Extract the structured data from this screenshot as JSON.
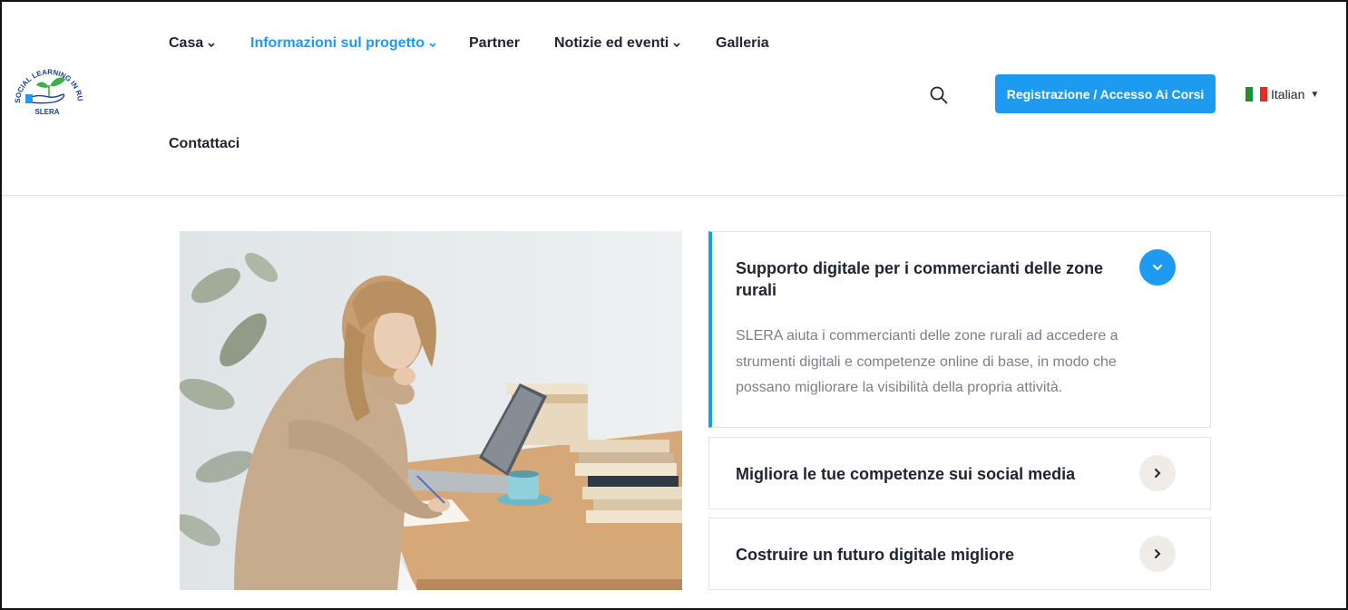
{
  "header": {
    "logo": {
      "arc_text": "SOCIAL LEARNING IN RURAL AREAS",
      "name": "SLERA"
    },
    "nav": [
      {
        "label": "Casa",
        "has_dropdown": true,
        "active": false
      },
      {
        "label": "Informazioni sul progetto",
        "has_dropdown": true,
        "active": true
      },
      {
        "label": "Partner",
        "has_dropdown": false,
        "active": false
      },
      {
        "label": "Notizie ed eventi",
        "has_dropdown": true,
        "active": false
      },
      {
        "label": "Galleria",
        "has_dropdown": false,
        "active": false
      },
      {
        "label": "Contattaci",
        "has_dropdown": false,
        "active": false
      }
    ],
    "search_icon": "search-icon",
    "cta_label": "Registrazione / Accesso Ai Corsi",
    "language": {
      "label": "Italian",
      "flag": "italy-flag"
    }
  },
  "colors": {
    "accent": "#1e9bf0",
    "text": "#1f2430",
    "muted": "#7c7f87",
    "grey_button": "#efece8"
  },
  "accordion": [
    {
      "title": "Supporto digitale per i commercianti delle zone rurali",
      "open": true,
      "icon": "chevron-down-icon",
      "body": "SLERA aiuta i commercianti delle zone rurali ad accedere a strumenti digitali e competenze online di base, in modo che possano migliorare la visibilità della propria attività."
    },
    {
      "title": "Migliora le tue competenze sui social media",
      "open": false,
      "icon": "chevron-right-icon"
    },
    {
      "title": "Costruire un futuro digitale migliore",
      "open": false,
      "icon": "chevron-right-icon"
    }
  ]
}
